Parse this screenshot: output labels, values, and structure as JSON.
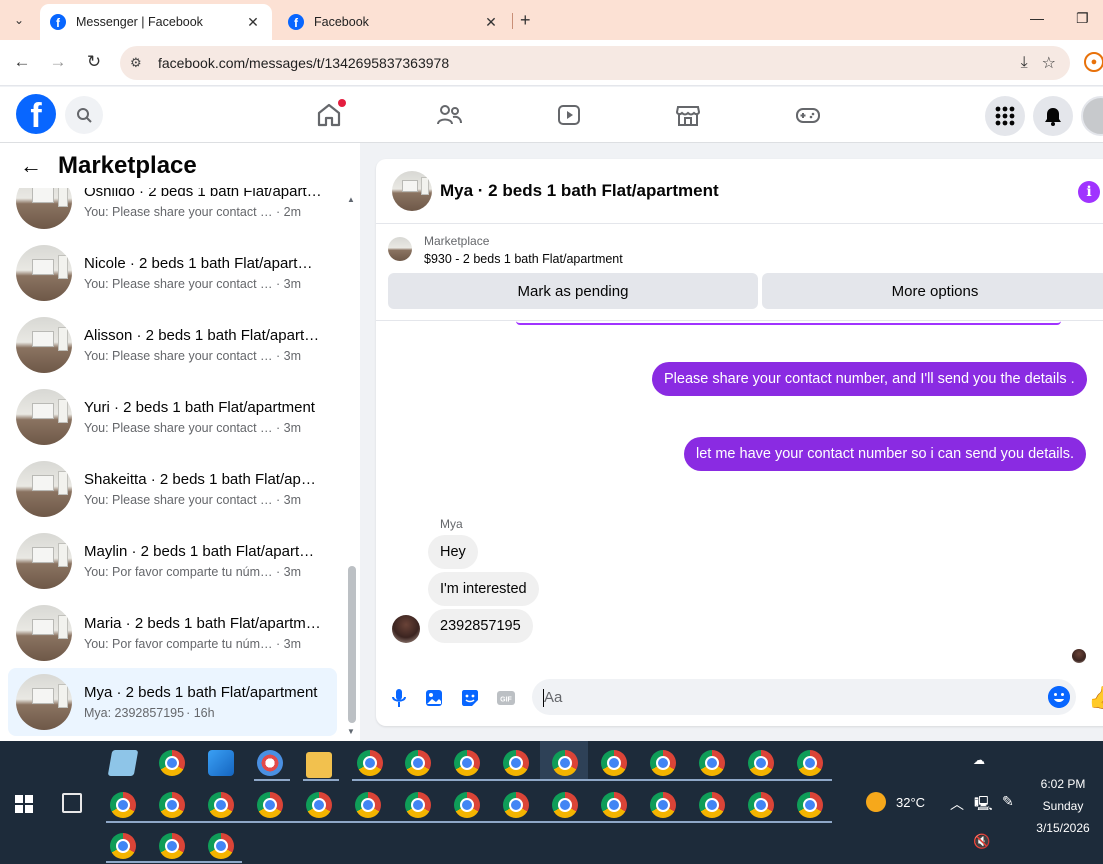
{
  "browser": {
    "tabs": [
      {
        "title": "Messenger | Facebook",
        "active": true
      },
      {
        "title": "Facebook",
        "active": false
      }
    ],
    "url": "facebook.com/messages/t/1342695837363978"
  },
  "sidebar": {
    "title": "Marketplace",
    "chats": [
      {
        "name": "Oshildo · 2 beds 1 bath Flat/apartment",
        "preview": "You: Please share your contact nu...",
        "time": "· 2m"
      },
      {
        "name": "Nicole · 2 beds 1 bath Flat/apartment",
        "preview": "You: Please share your contact nu...",
        "time": "· 3m"
      },
      {
        "name": "Alisson · 2 beds 1 bath Flat/apartment",
        "preview": "You: Please share your contact nu...",
        "time": "· 3m"
      },
      {
        "name": "Yuri · 2 beds 1 bath Flat/apartment",
        "preview": "You: Please share your contact nu...",
        "time": "· 3m"
      },
      {
        "name": "Shakeitta · 2 beds 1 bath Flat/apartment",
        "preview": "You: Please share your contact nu...",
        "time": "· 3m"
      },
      {
        "name": "Maylin · 2 beds 1 bath Flat/apartment",
        "preview": "You: Por favor comparte tu númer...",
        "time": "· 3m"
      },
      {
        "name": "Maria · 2 beds 1 bath Flat/apartment",
        "preview": "You: Por favor comparte tu númer...",
        "time": "· 3m"
      },
      {
        "name": "Mya · 2 beds 1 bath Flat/apartment",
        "preview": "Mya: 2392857195",
        "time": "· 16h",
        "selected": true
      }
    ]
  },
  "conversation": {
    "title": "Mya · 2 beds 1 bath Flat/apartment",
    "listing": {
      "label": "Marketplace",
      "price_title": "$930 - 2 beds 1 bath Flat/apartment",
      "mark_pending": "Mark as pending",
      "more_options": "More options"
    },
    "outgoing": [
      "Please share your contact number, and I'll send you the details .",
      "let me have your contact number so i can send you details."
    ],
    "sender": "Mya",
    "incoming": [
      "Hey",
      "I'm interested",
      "2392857195"
    ],
    "composer_placeholder": "Aa"
  },
  "taskbar": {
    "weather": "32°C",
    "time": "6:02 PM",
    "day": "Sunday",
    "date": "3/15/2026"
  },
  "colors": {
    "fb_blue": "#0866ff",
    "outgoing_bubble": "#8a2be2",
    "selected_chat": "#ebf5ff",
    "taskbar": "#1d2b3a",
    "tab_strip": "#fce1d4"
  }
}
